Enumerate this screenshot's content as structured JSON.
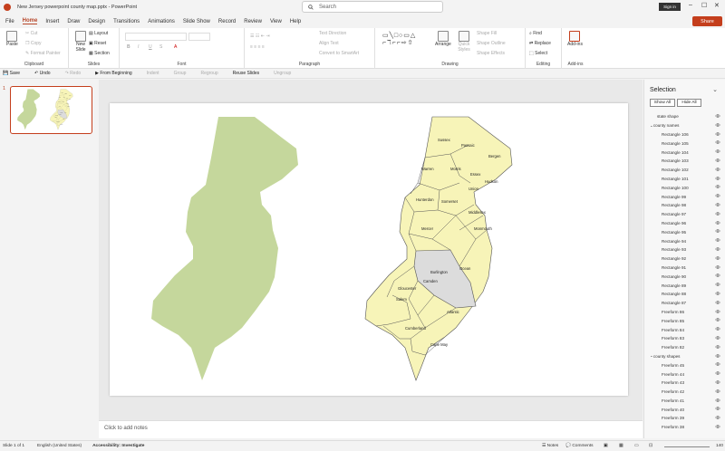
{
  "title_bar": {
    "doc_title": "New Jersey powerpoint county map.pptx - PowerPoint",
    "search_placeholder": "Search",
    "sign_in": "Sign in"
  },
  "menu": {
    "items": [
      "File",
      "Home",
      "Insert",
      "Draw",
      "Design",
      "Transitions",
      "Animations",
      "Slide Show",
      "Record",
      "Review",
      "View",
      "Help"
    ],
    "share": "Share"
  },
  "ribbon": {
    "clipboard": {
      "label": "Clipboard",
      "paste": "Paste",
      "cut": "Cut",
      "copy": "Copy",
      "format_painter": "Format Painter"
    },
    "slides": {
      "label": "Slides",
      "new_slide": "New Slide",
      "layout": "Layout",
      "reset": "Reset",
      "section": "Section"
    },
    "font": {
      "label": "Font"
    },
    "paragraph": {
      "label": "Paragraph",
      "text_direction": "Text Direction",
      "align_text": "Align Text",
      "convert_smartart": "Convert to SmartArt"
    },
    "drawing": {
      "label": "Drawing",
      "arrange": "Arrange",
      "quick_styles": "Quick Styles",
      "shape_fill": "Shape Fill",
      "shape_outline": "Shape Outline",
      "shape_effects": "Shape Effects"
    },
    "editing": {
      "label": "Editing",
      "find": "Find",
      "replace": "Replace",
      "select": "Select"
    },
    "addins": {
      "label": "Add-ins",
      "addins_btn": "Add-ins"
    }
  },
  "qat": {
    "save": "Save",
    "undo": "Undo",
    "redo": "Redo",
    "from_beginning": "From Beginning",
    "indent": "Indent",
    "group": "Group",
    "regroup": "Regroup",
    "reuse_slides": "Reuse Slides",
    "ungroup": "Ungroup"
  },
  "thumbnail": {
    "number": "1"
  },
  "map": {
    "state_fill": "#c5d79c",
    "county_fill": "#f7f4b8",
    "highlight_fill": "#dcdcdc",
    "counties": [
      "Sussex",
      "Passaic",
      "Bergen",
      "Warren",
      "Morris",
      "Essex",
      "Hudson",
      "Union",
      "Hunterdon",
      "Somerset",
      "Middlesex",
      "Mercer",
      "Monmouth",
      "Burlington",
      "Ocean",
      "Camden",
      "Gloucester",
      "Salem",
      "Atlantic",
      "Cumberland",
      "Cape May"
    ]
  },
  "notes_placeholder": "Click to add notes",
  "selection_pane": {
    "title": "Selection",
    "show_all": "Show All",
    "hide_all": "Hide All",
    "items": [
      {
        "label": "state shape",
        "indent": 0,
        "group": false
      },
      {
        "label": "county names",
        "indent": 0,
        "group": true
      },
      {
        "label": "Rectangle 106",
        "indent": 1,
        "group": false
      },
      {
        "label": "Rectangle 105",
        "indent": 1,
        "group": false
      },
      {
        "label": "Rectangle 104",
        "indent": 1,
        "group": false
      },
      {
        "label": "Rectangle 103",
        "indent": 1,
        "group": false
      },
      {
        "label": "Rectangle 102",
        "indent": 1,
        "group": false
      },
      {
        "label": "Rectangle 101",
        "indent": 1,
        "group": false
      },
      {
        "label": "Rectangle 100",
        "indent": 1,
        "group": false
      },
      {
        "label": "Rectangle 99",
        "indent": 1,
        "group": false
      },
      {
        "label": "Rectangle 98",
        "indent": 1,
        "group": false
      },
      {
        "label": "Rectangle 97",
        "indent": 1,
        "group": false
      },
      {
        "label": "Rectangle 96",
        "indent": 1,
        "group": false
      },
      {
        "label": "Rectangle 95",
        "indent": 1,
        "group": false
      },
      {
        "label": "Rectangle 94",
        "indent": 1,
        "group": false
      },
      {
        "label": "Rectangle 93",
        "indent": 1,
        "group": false
      },
      {
        "label": "Rectangle 92",
        "indent": 1,
        "group": false
      },
      {
        "label": "Rectangle 91",
        "indent": 1,
        "group": false
      },
      {
        "label": "Rectangle 90",
        "indent": 1,
        "group": false
      },
      {
        "label": "Rectangle 89",
        "indent": 1,
        "group": false
      },
      {
        "label": "Rectangle 88",
        "indent": 1,
        "group": false
      },
      {
        "label": "Rectangle 87",
        "indent": 1,
        "group": false
      },
      {
        "label": "Freeform 86",
        "indent": 1,
        "group": false
      },
      {
        "label": "Freeform 85",
        "indent": 1,
        "group": false
      },
      {
        "label": "Freeform 84",
        "indent": 1,
        "group": false
      },
      {
        "label": "Freeform 83",
        "indent": 1,
        "group": false
      },
      {
        "label": "Freeform 82",
        "indent": 1,
        "group": false
      },
      {
        "label": "county shapes",
        "indent": 0,
        "group": true
      },
      {
        "label": "Freeform 45",
        "indent": 1,
        "group": false
      },
      {
        "label": "Freeform 44",
        "indent": 1,
        "group": false
      },
      {
        "label": "Freeform 43",
        "indent": 1,
        "group": false
      },
      {
        "label": "Freeform 42",
        "indent": 1,
        "group": false
      },
      {
        "label": "Freeform 41",
        "indent": 1,
        "group": false
      },
      {
        "label": "Freeform 40",
        "indent": 1,
        "group": false
      },
      {
        "label": "Freeform 39",
        "indent": 1,
        "group": false
      },
      {
        "label": "Freeform 38",
        "indent": 1,
        "group": false
      }
    ]
  },
  "status": {
    "slide": "Slide 1 of 1",
    "language": "English (United States)",
    "accessibility": "Accessibility: Investigate",
    "notes": "Notes",
    "comments": "Comments",
    "zoom": "140"
  }
}
